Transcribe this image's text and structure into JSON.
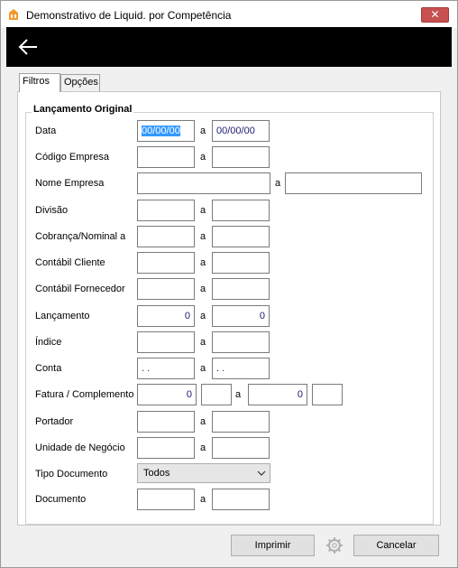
{
  "window": {
    "title": "Demonstrativo de  Liquid. por Competência",
    "close_glyph": "✕",
    "app_icon": "app-logo-icon"
  },
  "toolbar": {
    "back_icon": "back-arrow-icon"
  },
  "tabs": [
    {
      "label": "Filtros",
      "active": true
    },
    {
      "label": "Opções",
      "active": false
    }
  ],
  "group": {
    "title": "Lançamento Original"
  },
  "separator": "a",
  "fields": {
    "data": {
      "label": "Data",
      "from": "00/00/00",
      "to": "00/00/00"
    },
    "codigo_empresa": {
      "label": "Código Empresa",
      "from": "",
      "to": ""
    },
    "nome_empresa": {
      "label": "Nome Empresa",
      "from": "",
      "to": ""
    },
    "divisao": {
      "label": "Divisão",
      "from": "",
      "to": ""
    },
    "cobranca": {
      "label": "Cobrança/Nominal a",
      "from": "",
      "to": ""
    },
    "contabil_cliente": {
      "label": "Contábil Cliente",
      "from": "",
      "to": ""
    },
    "contabil_fornecedor": {
      "label": "Contábil Fornecedor",
      "from": "",
      "to": ""
    },
    "lancamento": {
      "label": "Lançamento",
      "from": "0",
      "to": "0"
    },
    "indice": {
      "label": "Índice",
      "from": "",
      "to": ""
    },
    "conta": {
      "label": "Conta",
      "from": " .  .",
      "to": " .  ."
    },
    "fatura": {
      "label": "Fatura / Complemento",
      "from": "0",
      "from_comp": "",
      "to": "0",
      "to_comp": ""
    },
    "portador": {
      "label": "Portador",
      "from": "",
      "to": ""
    },
    "unidade_negocio": {
      "label": "Unidade de Negócio",
      "from": "",
      "to": ""
    },
    "tipo_documento": {
      "label": "Tipo Documento",
      "selected": "Todos"
    },
    "documento": {
      "label": "Documento",
      "from": "",
      "to": ""
    }
  },
  "buttons": {
    "imprimir": "Imprimir",
    "settings_icon": "gear-icon",
    "cancelar": "Cancelar"
  }
}
